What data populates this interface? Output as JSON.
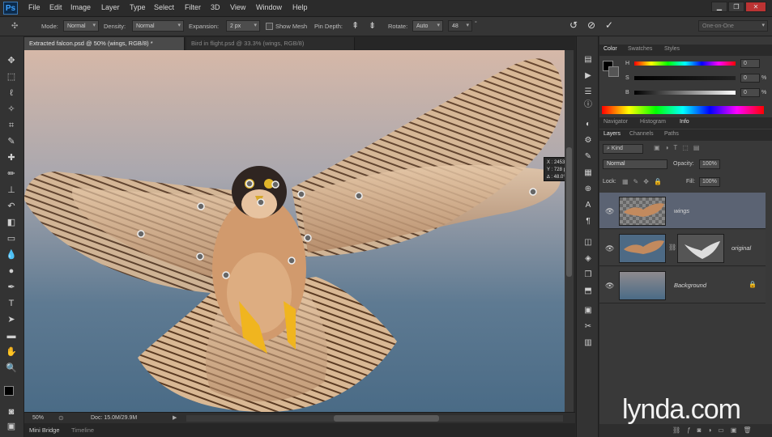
{
  "app": {
    "logo": "Ps"
  },
  "menubar": {
    "items": [
      "File",
      "Edit",
      "Image",
      "Layer",
      "Type",
      "Select",
      "Filter",
      "3D",
      "View",
      "Window",
      "Help"
    ]
  },
  "options": {
    "mode_label": "Mode:",
    "mode_value": "Normal",
    "density_label": "Density:",
    "density_value": "Normal",
    "expansion_label": "Expansion:",
    "expansion_value": "2 px",
    "show_mesh": "Show Mesh",
    "pin_depth_label": "Pin Depth:",
    "rotate_label": "Rotate:",
    "rotate_value": "Auto",
    "rotate_angle": "48",
    "workspace": "One-on-One"
  },
  "tabs": [
    {
      "label": "Extracted falcon.psd @ 50% (wings, RGB/8) *",
      "active": true
    },
    {
      "label": "Bird in flight.psd @ 33.3% (wings, RGB/8)",
      "active": false
    }
  ],
  "info_popup": {
    "x": "X : 2453 px",
    "y": "Y : 728 px",
    "angle": "∆ : 48.0°"
  },
  "status": {
    "zoom": "50%",
    "doc": "Doc: 15.0M/29.9M"
  },
  "bottom_tabs": [
    "Mini Bridge",
    "Timeline"
  ],
  "color_panel": {
    "tabs": [
      "Color",
      "Swatches",
      "Styles"
    ],
    "h_label": "H",
    "s_label": "S",
    "b_label": "B",
    "h_value": "0",
    "s_value": "0",
    "b_value": "0",
    "s_unit": "%",
    "b_unit": "%"
  },
  "nav_panel": {
    "tabs": [
      "Navigator",
      "Histogram",
      "Info"
    ]
  },
  "layers_panel": {
    "tabs": [
      "Layers",
      "Channels",
      "Paths"
    ],
    "filter": "Kind",
    "blend": "Normal",
    "opacity_label": "Opacity:",
    "opacity": "100%",
    "lock_label": "Lock:",
    "fill_label": "Fill:",
    "fill": "100%",
    "layers": [
      {
        "name": "wings",
        "selected": true
      },
      {
        "name": "original",
        "selected": false
      },
      {
        "name": "Background",
        "selected": false
      }
    ]
  },
  "watermark": "lynda.com",
  "colors": {
    "accent_blue": "#3a78b6",
    "bg_dark": "#282828",
    "panel": "#393939"
  }
}
